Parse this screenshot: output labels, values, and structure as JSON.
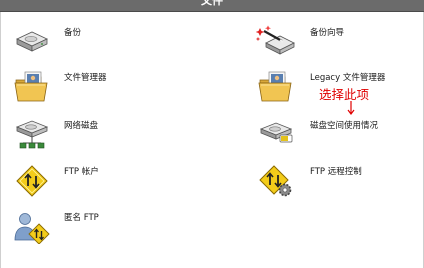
{
  "header": {
    "title": "文件"
  },
  "items": [
    {
      "label": "备份",
      "icon": "backup-drive-icon"
    },
    {
      "label": "备份向导",
      "icon": "backup-wizard-wand-icon"
    },
    {
      "label": "文件管理器",
      "icon": "file-manager-folder-icon"
    },
    {
      "label": "Legacy 文件管理器",
      "icon": "legacy-file-manager-folder-icon"
    },
    {
      "label": "网络磁盘",
      "icon": "network-disk-icon"
    },
    {
      "label": "磁盘空间使用情况",
      "icon": "disk-usage-icon"
    },
    {
      "label": "FTP 帐户",
      "icon": "ftp-accounts-icon"
    },
    {
      "label": "FTP 远程控制",
      "icon": "ftp-session-control-icon"
    },
    {
      "label": "匿名 FTP",
      "icon": "anonymous-ftp-icon"
    }
  ],
  "annotation": {
    "text": "选择此项",
    "color": "#e00000"
  }
}
